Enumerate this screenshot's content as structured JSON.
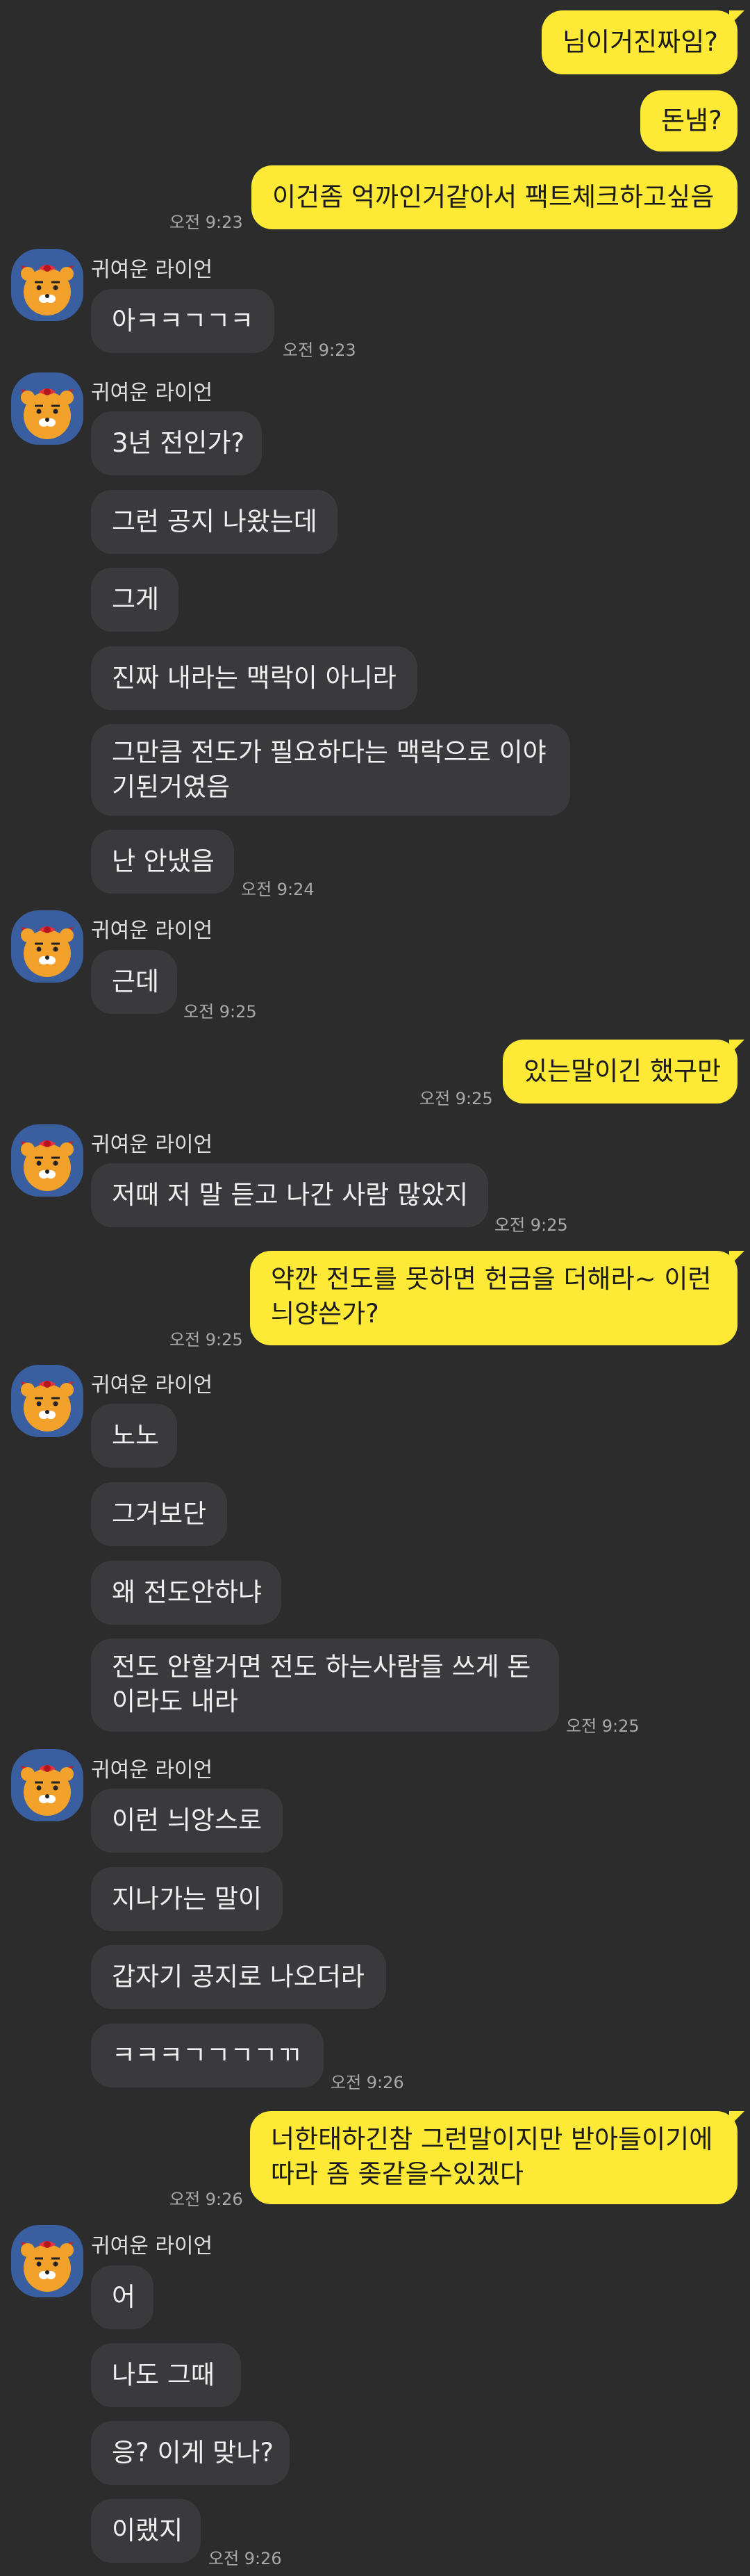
{
  "sender_name": "귀여운 라이언",
  "messages": [
    {
      "text": "님이거진짜임?"
    },
    {
      "text": "돈냄?"
    },
    {
      "text": "이건좀 억까인거같아서 팩트체크하고싶음",
      "time": "오전 9:23"
    },
    {
      "text": "아ㅋㅋㄱㄱㅋ",
      "time": "오전 9:23"
    },
    {
      "text": "3년 전인가?"
    },
    {
      "text": "그런 공지 나왔는데"
    },
    {
      "text": "그게"
    },
    {
      "text": "진짜 내라는 맥락이 아니라"
    },
    {
      "lines": [
        "그만큼 전도가 필요하다는 맥락으로 이야",
        "기된거였음"
      ]
    },
    {
      "text": "난 안냈음",
      "time": "오전 9:24"
    },
    {
      "text": "근데",
      "time": "오전 9:25"
    },
    {
      "text": "있는말이긴 했구만",
      "time": "오전 9:25"
    },
    {
      "text": "저때 저 말 듣고 나간 사람 많았지",
      "time": "오전 9:25"
    },
    {
      "lines": [
        "약깐 전도를 못하면 헌금을 더해라~ 이런",
        "늬양쓴가?"
      ],
      "time": "오전 9:25"
    },
    {
      "text": "노노"
    },
    {
      "text": "그거보단"
    },
    {
      "text": "왜 전도안하냐"
    },
    {
      "lines": [
        "전도 안할거면  전도 하는사람들 쓰게 돈",
        "이라도 내라"
      ],
      "time": "오전 9:25"
    },
    {
      "text": "이런 늬앙스로"
    },
    {
      "text": "지나가는 말이"
    },
    {
      "text": "갑자기 공지로 나오더라"
    },
    {
      "text": "ㅋㅋㅋㄱㄱㄱㄱㄲ",
      "time": "오전 9:26"
    },
    {
      "lines": [
        "너한태하긴참 그런말이지만 받아들이기에",
        "따라 좀 좆같을수있겠다"
      ],
      "time": "오전 9:26"
    },
    {
      "text": "어"
    },
    {
      "text": "나도  그때"
    },
    {
      "text": "응? 이게 맞나?"
    },
    {
      "text": "이랬지",
      "time": "오전 9:26"
    }
  ]
}
